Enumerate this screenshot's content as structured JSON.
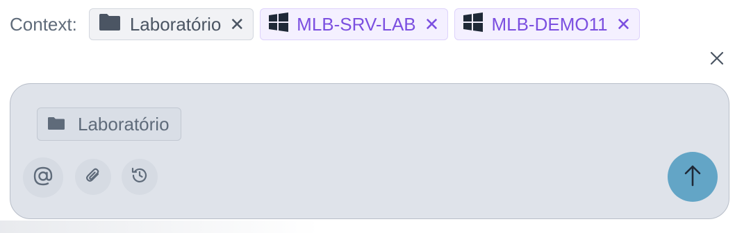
{
  "context": {
    "label": "Context:",
    "chips": [
      {
        "type": "folder",
        "icon": "folder-icon",
        "label": "Laboratório",
        "remove": "✕"
      },
      {
        "type": "machine",
        "icon": "windows-icon",
        "label": "MLB-SRV-LAB",
        "remove": "✕"
      },
      {
        "type": "machine",
        "icon": "windows-icon",
        "label": "MLB-DEMO11",
        "remove": "✕"
      }
    ]
  },
  "close": {
    "icon": "close-icon",
    "glyph": "✕"
  },
  "composer": {
    "attached_chip": {
      "icon": "folder-icon",
      "label": "Laboratório"
    },
    "tools": [
      {
        "icon": "at-sign-icon",
        "name": "mention"
      },
      {
        "icon": "paperclip-icon",
        "name": "attach"
      },
      {
        "icon": "history-icon",
        "name": "history"
      }
    ],
    "send": {
      "icon": "arrow-up-icon"
    }
  },
  "colors": {
    "accent_machine": "#7b4fe0",
    "send_button": "#63a5c6",
    "composer_bg": "#dfe3ea"
  }
}
